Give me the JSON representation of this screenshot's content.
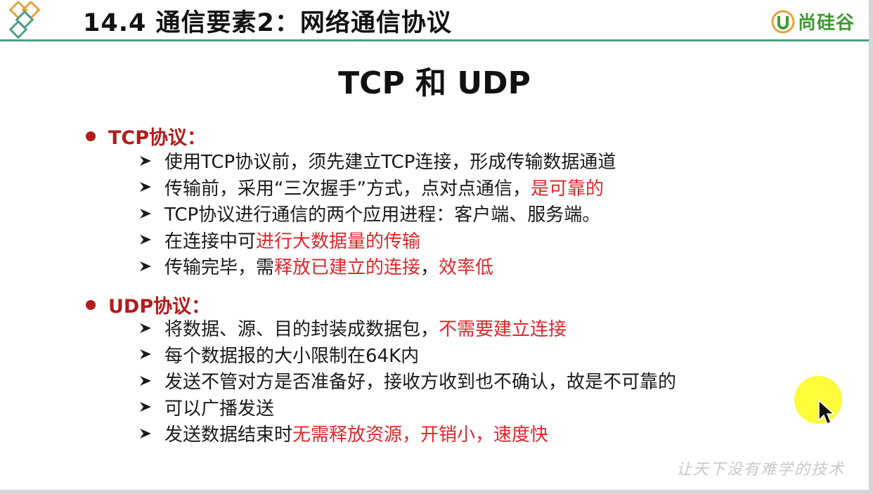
{
  "header": {
    "title": "14.4 通信要素2：网络通信协议",
    "brand_text": "尚硅谷",
    "accent_color": "#4f9c8c",
    "brand_color": "#3e9a2f"
  },
  "slide": {
    "title": "TCP 和 UDP"
  },
  "sections": [
    {
      "heading": "TCP协议：",
      "bullets": [
        [
          {
            "t": "使用TCP协议前，须先建立TCP连接，形成传输数据通道"
          }
        ],
        [
          {
            "t": "传输前，采用“三次握手”方式，点对点通信，"
          },
          {
            "t": "是可靠的",
            "red": true
          }
        ],
        [
          {
            "t": "TCP协议进行通信的两个应用进程：客户端、服务端。"
          }
        ],
        [
          {
            "t": "在连接中可"
          },
          {
            "t": "进行大数据量的传输",
            "red": true
          }
        ],
        [
          {
            "t": "传输完毕，需"
          },
          {
            "t": "释放已建立的连接",
            "red": true
          },
          {
            "t": "，"
          },
          {
            "t": "效率低",
            "red": true
          }
        ]
      ]
    },
    {
      "heading": "UDP协议：",
      "bullets": [
        [
          {
            "t": "将数据、源、目的封装成数据包，"
          },
          {
            "t": "不需要建立连接",
            "red": true
          }
        ],
        [
          {
            "t": "每个数据报的大小限制在64K内"
          }
        ],
        [
          {
            "t": "发送不管对方是否准备好，接收方收到也不确认，故是不可靠的"
          }
        ],
        [
          {
            "t": "可以广播发送"
          }
        ],
        [
          {
            "t": "发送数据结束时"
          },
          {
            "t": "无需释放资源，开销小，速度快",
            "red": true
          }
        ]
      ]
    }
  ],
  "watermark": "让天下没有难学的技术",
  "colors": {
    "heading_red": "#b31b1b",
    "highlight_red": "#e0262b",
    "cursor_highlight": "#fbfb2e"
  },
  "icons": {
    "logo": "diamond-logo-icon",
    "brand": "brand-logo-icon",
    "bullet": "arrow-bullet-icon",
    "cursor": "mouse-cursor-icon"
  }
}
